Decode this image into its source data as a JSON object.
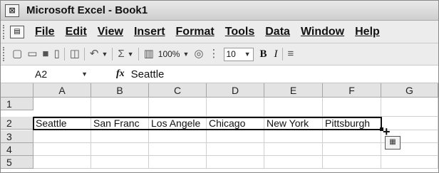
{
  "window": {
    "title": "Microsoft Excel - Book1"
  },
  "icons": {
    "app": "excel-app-icon",
    "doc": "workbook-icon"
  },
  "menu": [
    "File",
    "Edit",
    "View",
    "Insert",
    "Format",
    "Tools",
    "Data",
    "Window",
    "Help"
  ],
  "toolbar": {
    "zoom": "100%",
    "font_size": "10",
    "bold_label": "B",
    "italic_label": "I",
    "sum_label": "Σ"
  },
  "formula_bar": {
    "name_box": "A2",
    "fx_label": "fx",
    "formula": "Seattle"
  },
  "sheet": {
    "columns": [
      "A",
      "B",
      "C",
      "D",
      "E",
      "F",
      "G"
    ],
    "rows": [
      "1",
      "2",
      "3",
      "4",
      "5"
    ],
    "row2": [
      "Seattle",
      "San Franc",
      "Los Angele",
      "Chicago",
      "New York",
      "Pittsburgh",
      ""
    ]
  },
  "colors": {
    "selection_border": "#111111",
    "header_bg": "#e3e3e3"
  }
}
